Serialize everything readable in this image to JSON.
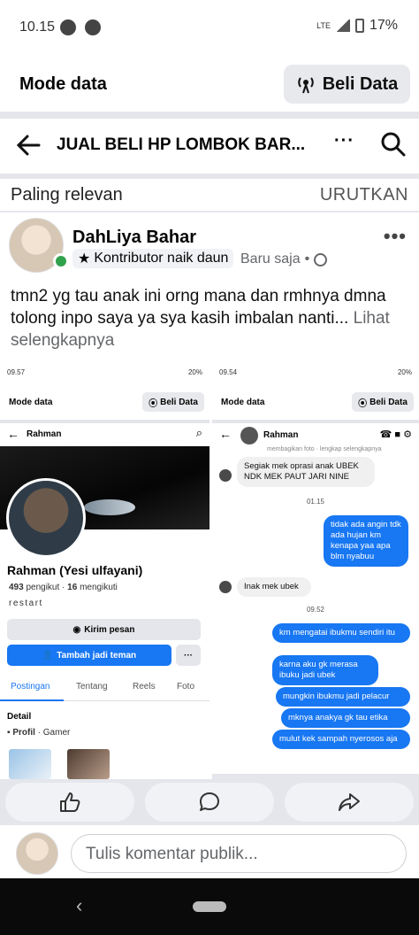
{
  "status_bar": {
    "time": "10.15",
    "battery": "17%",
    "network": "LTE"
  },
  "mode_bar": {
    "label": "Mode data",
    "button": "Beli Data"
  },
  "header": {
    "title": "JUAL BELI HP LOMBOK BAR...",
    "more": "···"
  },
  "sort": {
    "label": "Paling relevan",
    "button": "URUTKAN"
  },
  "post": {
    "author": "DahLiya Bahar",
    "badge": "Kontributor naik daun",
    "time": "Baru saja",
    "text": "tmn2 yg tau anak ini orng mana dan rmhnya dmna tolong inpo saya ya sya kasih imbalan nanti...",
    "see_more": "Lihat selengkapnya"
  },
  "left_shot": {
    "status_time": "09.57",
    "status_right": "20%",
    "mode_label": "Mode data",
    "mode_button": "Beli Data",
    "header_name": "Rahman",
    "profile_name": "Rahman (Yesi ulfayani)",
    "followers": "493",
    "followers_label": "pengikut",
    "following": "16",
    "following_label": "mengikuti",
    "bio": "restart",
    "message_button": "Kirim pesan",
    "add_button": "Tambah jadi teman",
    "more_button": "···",
    "tabs": [
      "Postingan",
      "Tentang",
      "Reels",
      "Foto"
    ],
    "detail_title": "Detail",
    "profile_line_bold": "Profil",
    "profile_line_rest": "· Gamer"
  },
  "right_shot": {
    "status_time": "09.54",
    "status_right": "20%",
    "mode_label": "Mode data",
    "mode_button": "Beli Data",
    "chat_name": "Rahman",
    "cut_text": "membagikan foto · lengkap selengkapnya",
    "messages": [
      {
        "dir": "in",
        "text": "Segiak mek oprasi anak UBEK NDK MEK PAUT JARI NINE"
      },
      {
        "dir": "time",
        "text": "01.15"
      },
      {
        "dir": "out",
        "text": "tidak ada angin tdk ada hujan km kenapa yaa apa blm nyabuu"
      },
      {
        "dir": "in",
        "text": "Inak mek ubek"
      },
      {
        "dir": "time",
        "text": "09.52"
      },
      {
        "dir": "out",
        "text": "km mengatai ibukmu sendiri itu"
      },
      {
        "dir": "out",
        "text": "karna aku gk merasa ibuku jadi ubek"
      },
      {
        "dir": "out",
        "text": "mungkin ibukmu jadi pelacur"
      },
      {
        "dir": "out",
        "text": "mknya anakya gk tau etika"
      },
      {
        "dir": "out",
        "text": "mulut kek sampah nyerosos aja"
      }
    ]
  },
  "actions": {
    "like": "like-icon",
    "comment": "comment-icon",
    "share": "share-icon"
  },
  "comment": {
    "placeholder": "Tulis komentar publik..."
  },
  "colors": {
    "accent": "#1877f2",
    "online": "#31a24c",
    "divider": "#e4e6eb"
  }
}
